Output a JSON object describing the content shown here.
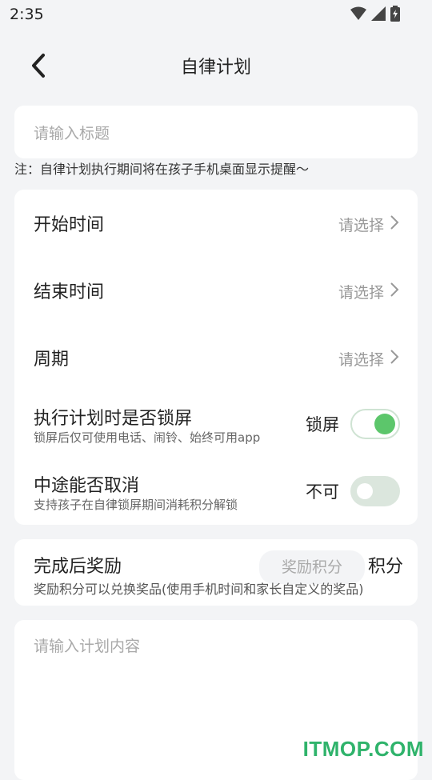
{
  "status_bar": {
    "time": "2:35",
    "icons": [
      "wifi-icon",
      "signal-icon",
      "battery-icon"
    ]
  },
  "header": {
    "title": "自律计划",
    "back_icon": "chevron-left-icon"
  },
  "title_input": {
    "placeholder": "请输入标题",
    "value": ""
  },
  "note": "注：自律计划执行期间将在孩子手机桌面显示提醒～",
  "schedule": {
    "start": {
      "label": "开始时间",
      "value": "请选择"
    },
    "end": {
      "label": "结束时间",
      "value": "请选择"
    },
    "period": {
      "label": "周期",
      "value": "请选择"
    },
    "lock": {
      "label": "执行计划时是否锁屏",
      "sub": "锁屏后仅可使用电话、闹铃、始终可用app",
      "toggle_label": "锁屏",
      "on": true
    },
    "cancel": {
      "label": "中途能否取消",
      "sub": "支持孩子在自律锁屏期间消耗积分解锁",
      "toggle_label": "不可",
      "on": false
    }
  },
  "reward": {
    "label": "完成后奖励",
    "input_placeholder": "奖励积分",
    "unit": "积分",
    "sub": "奖励积分可以兑换奖品(使用手机时间和家长自定义的奖品)"
  },
  "content_input": {
    "placeholder": "请输入计划内容",
    "value": ""
  },
  "watermark": "ITMOP.COM",
  "colors": {
    "accent": "#5cc66b",
    "background": "#f3f4f6",
    "card": "#ffffff",
    "watermark": "#2fb36b"
  }
}
